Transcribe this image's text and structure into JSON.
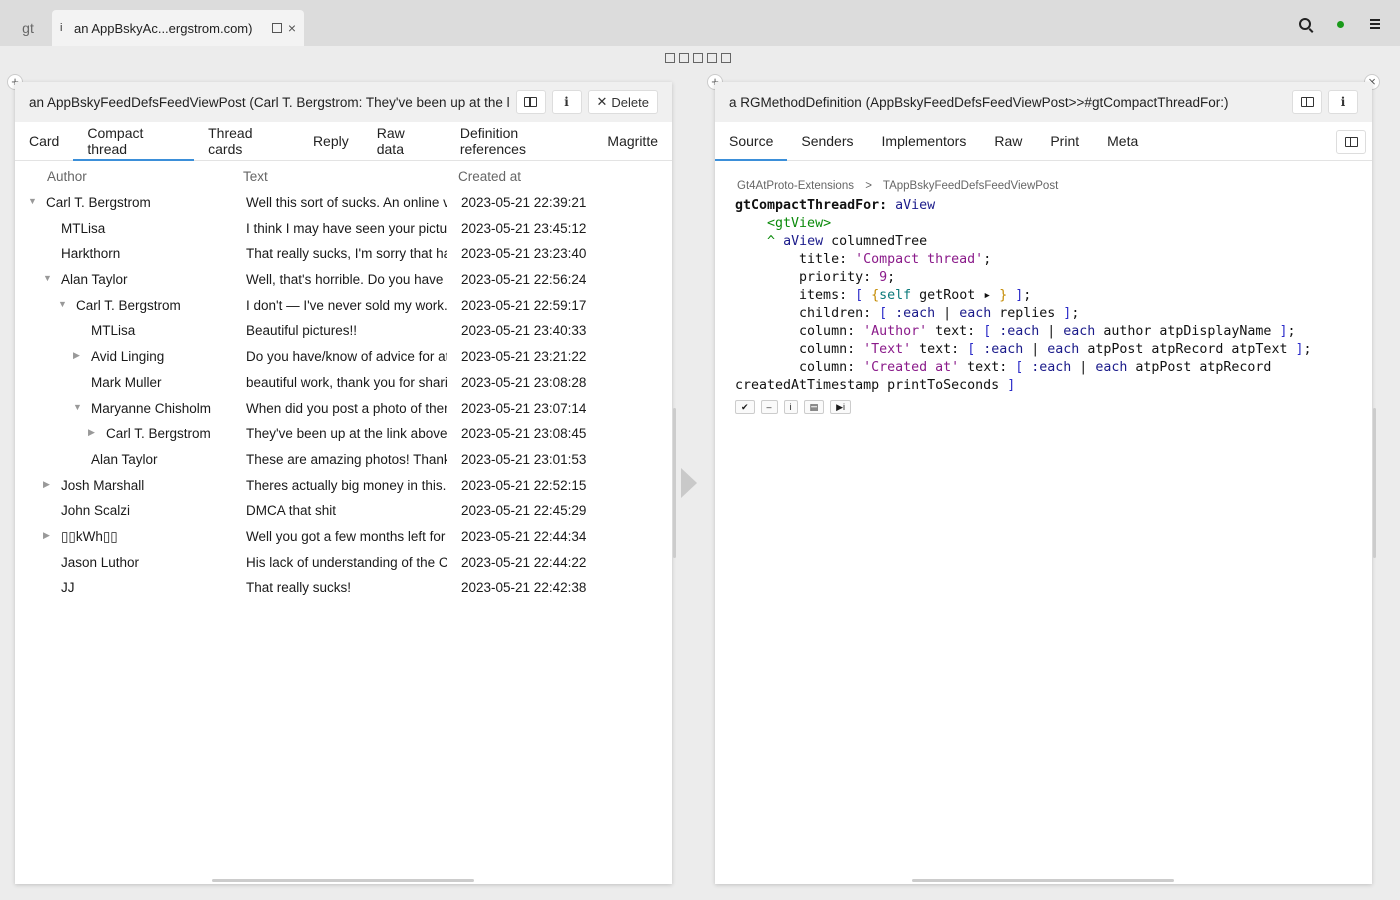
{
  "topbar": {
    "home_label": "gt",
    "tab_icon": "i",
    "tab_title": "an AppBskyAc...ergstrom.com)",
    "tab_close": "×"
  },
  "left_pane": {
    "title": "an AppBskyFeedDefsFeedViewPost (Carl T. Bergstrom: They've been up at the link above for a couple days)",
    "delete_label": "Delete",
    "tabs": [
      "Card",
      "Compact thread",
      "Thread cards",
      "Reply",
      "Raw data",
      "Definition references",
      "Magritte"
    ],
    "active_tab": "Compact thread",
    "columns": {
      "author": "Author",
      "text": "Text",
      "created": "Created at"
    },
    "rows": [
      {
        "author": "Carl T. Bergstrom",
        "text": "Well this sort of sucks. An online venue",
        "created": "2023-05-21 22:39:21",
        "depth": 0,
        "toggle": "open"
      },
      {
        "author": "MTLisa",
        "text": "I think I may have seen your pictures",
        "created": "2023-05-21 23:45:12",
        "depth": 1,
        "toggle": "none"
      },
      {
        "author": "Harkthorn",
        "text": "That really sucks, I'm sorry that happened",
        "created": "2023-05-21 23:23:40",
        "depth": 1,
        "toggle": "none"
      },
      {
        "author": "Alan Taylor",
        "text": "Well, that's horrible. Do you have any",
        "created": "2023-05-21 22:56:24",
        "depth": 1,
        "toggle": "open"
      },
      {
        "author": "Carl T. Bergstrom",
        "text": "I don't — I've never sold my work. I",
        "created": "2023-05-21 22:59:17",
        "depth": 2,
        "toggle": "open"
      },
      {
        "author": "MTLisa",
        "text": "Beautiful pictures!!",
        "created": "2023-05-21 23:40:33",
        "depth": 3,
        "toggle": "none"
      },
      {
        "author": "Avid Linging",
        "text": "Do you have/know of advice for attribution",
        "created": "2023-05-21 23:21:22",
        "depth": 3,
        "toggle": "closed"
      },
      {
        "author": "Mark Muller",
        "text": "beautiful work, thank you for sharing",
        "created": "2023-05-21 23:08:28",
        "depth": 3,
        "toggle": "none"
      },
      {
        "author": "Maryanne Chisholm",
        "text": "When did you post a photo of them",
        "created": "2023-05-21 23:07:14",
        "depth": 3,
        "toggle": "open"
      },
      {
        "author": "Carl T. Bergstrom",
        "text": "They've been up at the link above for",
        "created": "2023-05-21 23:08:45",
        "depth": 4,
        "toggle": "closed"
      },
      {
        "author": "Alan Taylor",
        "text": "These are amazing photos! Thanks",
        "created": "2023-05-21 23:01:53",
        "depth": 3,
        "toggle": "none"
      },
      {
        "author": "Josh Marshall",
        "text": "Theres actually big money in this. I",
        "created": "2023-05-21 22:52:15",
        "depth": 1,
        "toggle": "closed"
      },
      {
        "author": "John Scalzi",
        "text": "DMCA that shit",
        "created": "2023-05-21 22:45:29",
        "depth": 1,
        "toggle": "none"
      },
      {
        "author": "▯▯kWh▯▯",
        "text": "Well you got a few months left for the",
        "created": "2023-05-21 22:44:34",
        "depth": 1,
        "toggle": "closed"
      },
      {
        "author": "Jason Luthor",
        "text": "His lack of understanding of the Copyright",
        "created": "2023-05-21 22:44:22",
        "depth": 1,
        "toggle": "none"
      },
      {
        "author": "JJ",
        "text": "That really sucks!",
        "created": "2023-05-21 22:42:38",
        "depth": 1,
        "toggle": "none"
      }
    ]
  },
  "right_pane": {
    "title": "a RGMethodDefinition (AppBskyFeedDefsFeedViewPost>>#gtCompactThreadFor:)",
    "tabs": [
      "Source",
      "Senders",
      "Implementors",
      "Raw",
      "Print",
      "Meta"
    ],
    "active_tab": "Source",
    "breadcrumb": {
      "package": "Gt4AtProto-Extensions",
      "separator": ">",
      "class": "TAppBskyFeedDefsFeedViewPost"
    },
    "code_lines": [
      "gtCompactThreadFor: aView",
      "    <gtView>",
      "    ^ aView columnedTree",
      "        title: 'Compact thread';",
      "        priority: 9;",
      "        items: [ {self getRoot ▸ } ];",
      "        children: [ :each | each replies ];",
      "        column: 'Author' text: [ :each | each author atpDisplayName ];",
      "        column: 'Text' text: [ :each | each atpPost atpRecord atpText ];",
      "        column: 'Created at' text: [ :each | each atpPost atpRecord",
      "createdAtTimestamp printToSeconds ]"
    ],
    "code_toolbar": [
      "✔",
      "–",
      "i",
      "▤",
      "▶i"
    ]
  }
}
